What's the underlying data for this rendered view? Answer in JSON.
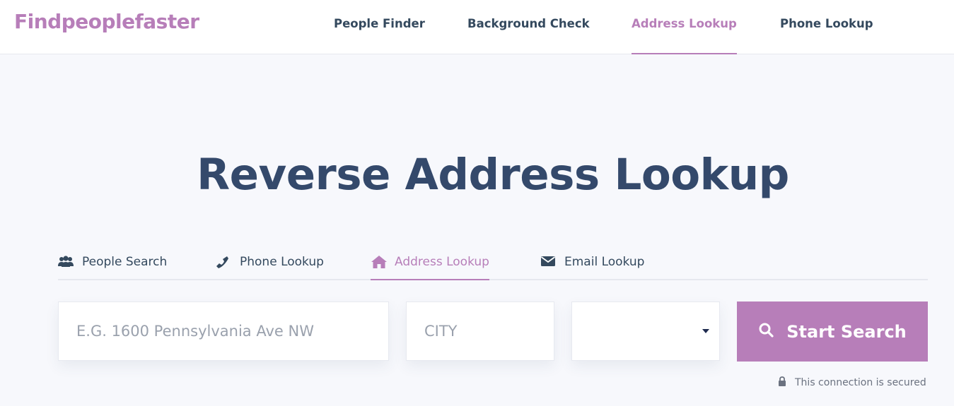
{
  "brand": {
    "logo": "Findpeoplefaster",
    "accent": "#b77eb9",
    "text": "#34496b"
  },
  "topnav": [
    {
      "label": "People Finder"
    },
    {
      "label": "Background Check"
    },
    {
      "label": "Address Lookup",
      "active": true
    },
    {
      "label": "Phone Lookup"
    }
  ],
  "hero": {
    "title": "Reverse Address Lookup"
  },
  "tabs": [
    {
      "label": "People Search",
      "icon": "users-icon"
    },
    {
      "label": "Phone Lookup",
      "icon": "phone-icon"
    },
    {
      "label": "Address Lookup",
      "icon": "home-icon",
      "active": true
    },
    {
      "label": "Email Lookup",
      "icon": "envelope-icon"
    }
  ],
  "form": {
    "address_placeholder": "E.G. 1600 Pennsylvania Ave NW",
    "city_placeholder": "CITY",
    "state_value": "",
    "submit_label": "Start Search"
  },
  "footer": {
    "secured_text": "This connection is secured"
  }
}
